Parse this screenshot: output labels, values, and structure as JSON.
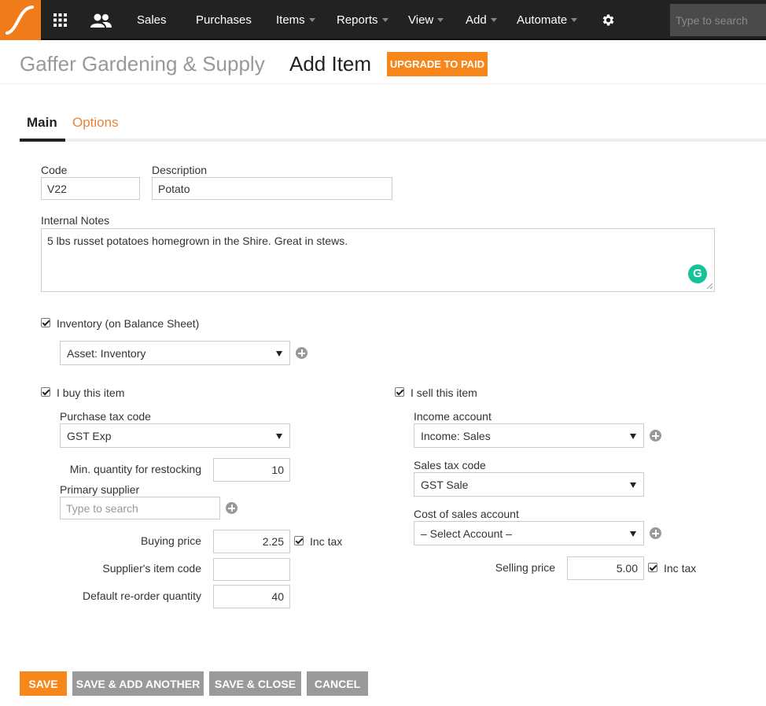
{
  "colors": {
    "accent": "#f7861b",
    "nav_bg": "#222222",
    "tab_active_link": "#e8843a",
    "grammarly": "#15c39a"
  },
  "nav": {
    "logo_icon": "app-logo-swoosh",
    "apps_icon": "grid-icon",
    "people_icon": "contacts-icon",
    "items": [
      {
        "label": "Sales",
        "dropdown": false
      },
      {
        "label": "Purchases",
        "dropdown": false
      },
      {
        "label": "Items",
        "dropdown": true
      },
      {
        "label": "Reports",
        "dropdown": true
      },
      {
        "label": "View",
        "dropdown": true
      },
      {
        "label": "Add",
        "dropdown": true
      },
      {
        "label": "Automate",
        "dropdown": true
      }
    ],
    "settings_icon": "gear-icon",
    "search_placeholder": "Type to search"
  },
  "header": {
    "company": "Gaffer Gardening & Supply",
    "title": "Add Item",
    "upgrade_label": "UPGRADE TO PAID"
  },
  "tabs": [
    {
      "label": "Main",
      "active": true
    },
    {
      "label": "Options",
      "active": false
    }
  ],
  "form": {
    "code": {
      "label": "Code",
      "value": "V22"
    },
    "description": {
      "label": "Description",
      "value": "Potato"
    },
    "notes": {
      "label": "Internal Notes",
      "value": "5 lbs russet potatoes homegrown in the Shire. Great in stews."
    },
    "inventory": {
      "label": "Inventory (on Balance Sheet)",
      "checked": true,
      "account": "Asset: Inventory"
    },
    "buy": {
      "label": "I buy this item",
      "checked": true,
      "tax_code_label": "Purchase tax code",
      "tax_code": "GST Exp",
      "min_qty_label": "Min. quantity for restocking",
      "min_qty": "10",
      "supplier_label": "Primary supplier",
      "supplier_placeholder": "Type to search",
      "price_label": "Buying price",
      "price": "2.25",
      "inc_tax_label": "Inc tax",
      "inc_tax": true,
      "supplier_code_label": "Supplier's item code",
      "supplier_code": "",
      "reorder_label": "Default re-order quantity",
      "reorder": "40"
    },
    "sell": {
      "label": "I sell this item",
      "checked": true,
      "income_label": "Income account",
      "income": "Income: Sales",
      "tax_code_label": "Sales tax code",
      "tax_code": "GST Sale",
      "cos_label": "Cost of sales account",
      "cos": "– Select Account –",
      "price_label": "Selling price",
      "price": "5.00",
      "inc_tax_label": "Inc tax",
      "inc_tax": true
    }
  },
  "actions": {
    "save": "SAVE",
    "save_add": "SAVE & ADD ANOTHER",
    "save_close": "SAVE & CLOSE",
    "cancel": "CANCEL"
  }
}
